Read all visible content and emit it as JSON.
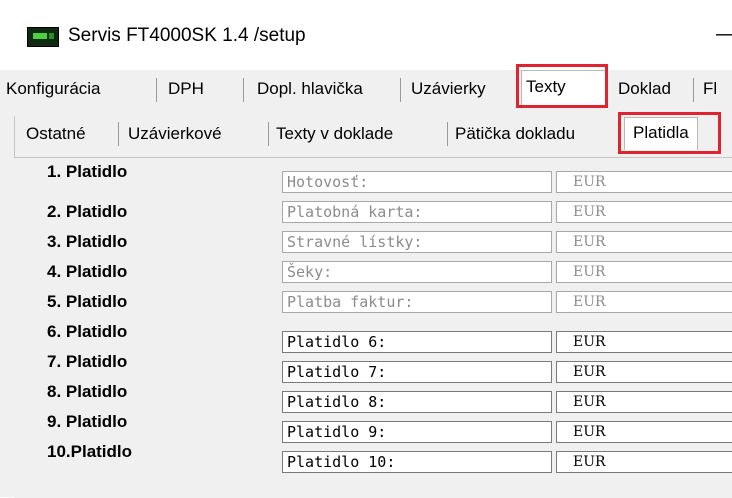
{
  "window": {
    "title": "Servis FT4000SK 1.4 /setup",
    "minimize_glyph": "—"
  },
  "main_tabs": [
    {
      "label": "Konfigurácia"
    },
    {
      "label": "DPH"
    },
    {
      "label": "Dopl. hlavička"
    },
    {
      "label": "Uzávierky"
    },
    {
      "label": "Texty",
      "selected": true
    },
    {
      "label": "Doklad"
    },
    {
      "label": "Fl"
    }
  ],
  "sub_tabs": [
    {
      "label": "Ostatné"
    },
    {
      "label": "Uzávierkové"
    },
    {
      "label": "Texty v doklade"
    },
    {
      "label": "Pätička dokladu"
    },
    {
      "label": "Platidla",
      "selected": true
    }
  ],
  "platidla": [
    {
      "label": "1. Platidlo",
      "name": "Hotovosť:",
      "currency": "EUR",
      "enabled": false
    },
    {
      "label": "2. Platidlo",
      "name": "Platobná karta:",
      "currency": "EUR",
      "enabled": false
    },
    {
      "label": "3. Platidlo",
      "name": "Stravné lístky:",
      "currency": "EUR",
      "enabled": false
    },
    {
      "label": "4. Platidlo",
      "name": "Šeky:",
      "currency": "EUR",
      "enabled": false
    },
    {
      "label": "5. Platidlo",
      "name": "Platba faktur:",
      "currency": "EUR",
      "enabled": false
    },
    {
      "label": "6. Platidlo",
      "name": "Platidlo 6:",
      "currency": "EUR",
      "enabled": true
    },
    {
      "label": "7. Platidlo",
      "name": "Platidlo 7:",
      "currency": "EUR",
      "enabled": true
    },
    {
      "label": "8. Platidlo",
      "name": "Platidlo 8:",
      "currency": "EUR",
      "enabled": true
    },
    {
      "label": "9. Platidlo",
      "name": "Platidlo 9:",
      "currency": "EUR",
      "enabled": true
    },
    {
      "label": "10.Platidlo",
      "name": "Platidlo 10:",
      "currency": "EUR",
      "enabled": true
    }
  ],
  "colors": {
    "highlight": "#e0242f",
    "disabled_text": "#8c8c8c"
  }
}
